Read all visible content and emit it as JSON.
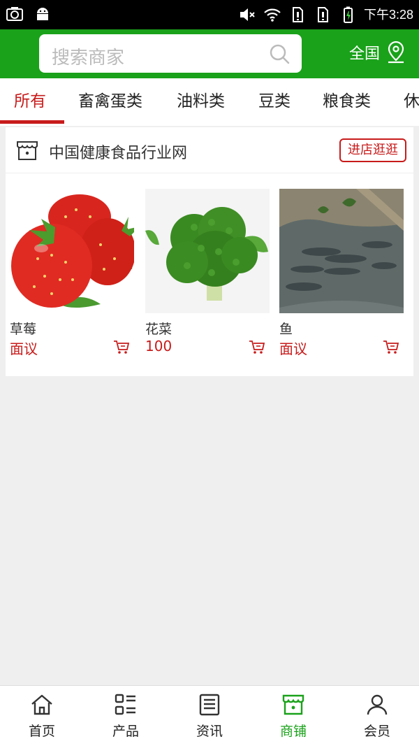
{
  "status_bar": {
    "time": "下午3:28"
  },
  "header": {
    "search_placeholder": "搜索商家",
    "region_label": "全国"
  },
  "tabs": [
    "所有",
    "畜禽蛋类",
    "油料类",
    "豆类",
    "粮食类",
    "休"
  ],
  "store": {
    "name": "中国健康食品行业网",
    "visit_label": "进店逛逛"
  },
  "products": [
    {
      "name": "草莓",
      "price": "面议"
    },
    {
      "name": "花菜",
      "price": "100"
    },
    {
      "name": "鱼",
      "price": "面议"
    }
  ],
  "bottom_nav": [
    {
      "label": "首页",
      "icon": "home-icon"
    },
    {
      "label": "产品",
      "icon": "list-icon"
    },
    {
      "label": "资讯",
      "icon": "news-icon"
    },
    {
      "label": "商铺",
      "icon": "store-icon"
    },
    {
      "label": "会员",
      "icon": "user-icon"
    }
  ],
  "colors": {
    "brand_green": "#1aa21a",
    "accent_red": "#c81b1b"
  }
}
